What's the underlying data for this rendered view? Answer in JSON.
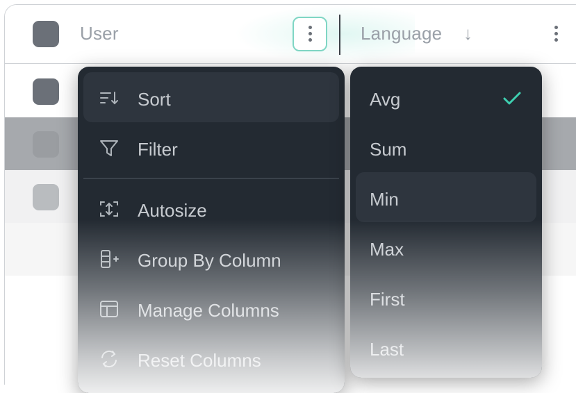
{
  "header": {
    "user_label": "User",
    "language_label": "Language",
    "sort_indicator": "↓"
  },
  "rows": [
    {
      "selected": false
    },
    {
      "selected": false
    },
    {
      "selected": false
    }
  ],
  "column_menu": {
    "items": [
      {
        "label": "Sort",
        "icon": "sort-icon",
        "active": true
      },
      {
        "label": "Filter",
        "icon": "filter-icon"
      },
      {
        "label": "Autosize",
        "icon": "autosize-icon"
      },
      {
        "label": "Group By Column",
        "icon": "group-by-icon"
      },
      {
        "label": "Manage Columns",
        "icon": "manage-columns-icon"
      },
      {
        "label": "Reset Columns",
        "icon": "reset-icon"
      }
    ]
  },
  "aggregate_menu": {
    "selected": "Avg",
    "items": [
      {
        "label": "Avg",
        "checked": true
      },
      {
        "label": "Sum"
      },
      {
        "label": "Min",
        "hover": true
      },
      {
        "label": "Max"
      },
      {
        "label": "First"
      },
      {
        "label": "Last"
      }
    ]
  },
  "colors": {
    "accent": "#3ecfb0",
    "menu_bg": "#232a32",
    "menu_text": "#c7cbd0"
  }
}
